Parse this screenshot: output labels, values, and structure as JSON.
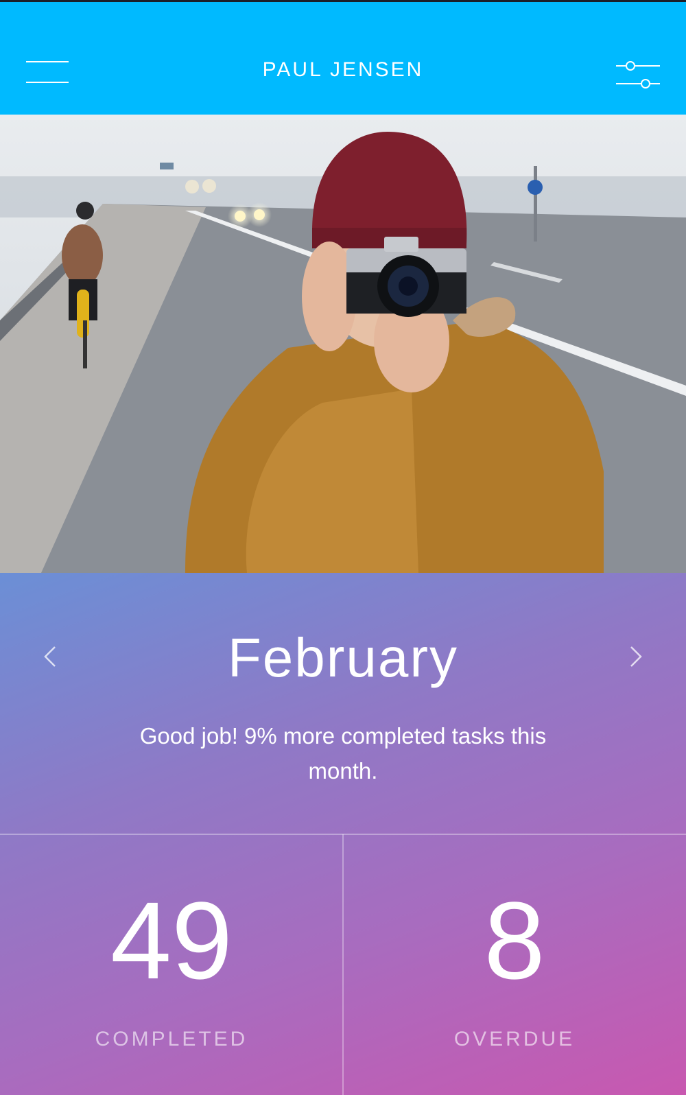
{
  "header": {
    "title": "PAUL JENSEN",
    "menu_icon": "hamburger-menu-icon",
    "filter_icon": "sliders-filter-icon",
    "background_color": "#00baff"
  },
  "hero": {
    "image_name": "profile-photo"
  },
  "month_view": {
    "month": "February",
    "message": "Good job! 9% more completed tasks this month.",
    "prev_icon": "chevron-left-icon",
    "next_icon": "chevron-right-icon"
  },
  "stats": [
    {
      "value": "49",
      "label": "COMPLETED"
    },
    {
      "value": "8",
      "label": "OVERDUE"
    }
  ],
  "colors": {
    "gradient_start": "#6b8fd6",
    "gradient_end": "#c858b0",
    "text": "#ffffff"
  }
}
